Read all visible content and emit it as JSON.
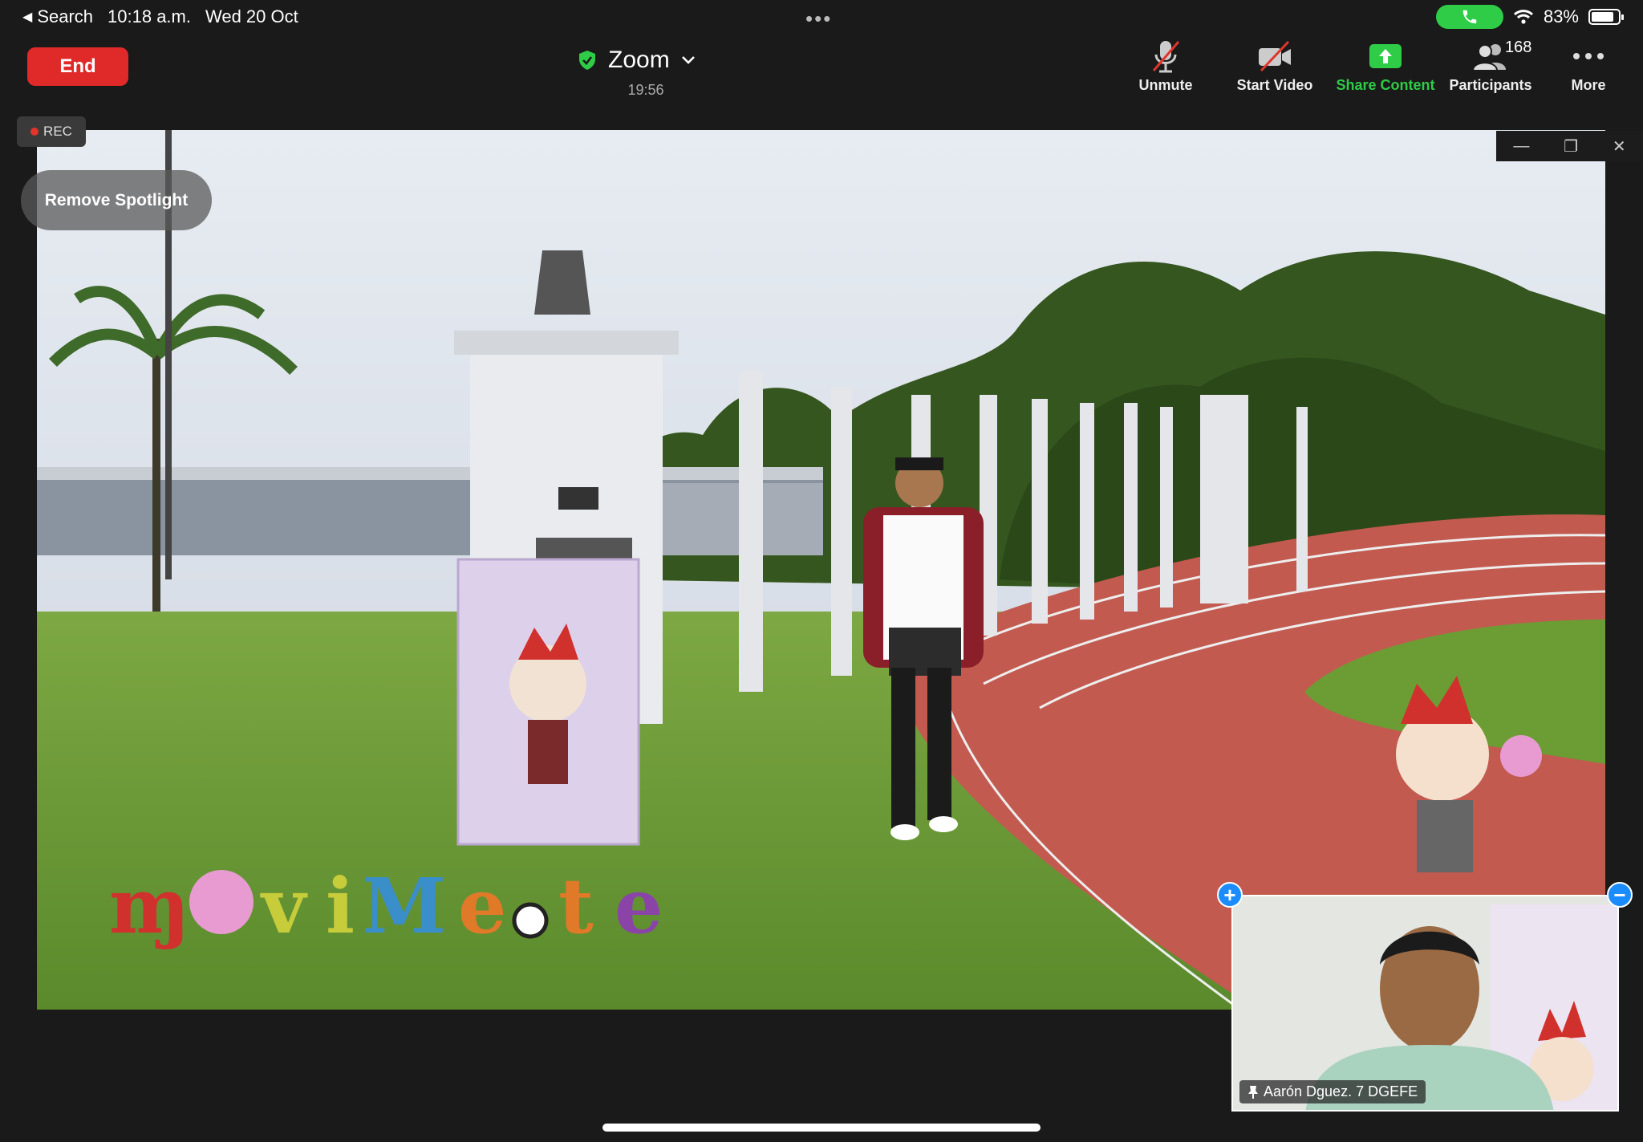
{
  "status_bar": {
    "back_label": "Search",
    "time": "10:18 a.m.",
    "date": "Wed 20 Oct",
    "battery": "83%",
    "battery_level": 0.83
  },
  "toolbar": {
    "end_label": "End",
    "meeting_title": "Zoom",
    "meeting_time": "19:56",
    "unmute_label": "Unmute",
    "start_video_label": "Start Video",
    "share_label": "Share Content",
    "participants_label": "Participants",
    "participants_count": "168",
    "more_label": "More"
  },
  "stage": {
    "rec_label": "REC",
    "remove_spotlight_label": "Remove Spotlight"
  },
  "thumbnail": {
    "participant_name": "Aarón Dguez. 7 DGEFE"
  },
  "colors": {
    "end": "#e02a2a",
    "share": "#2ecc47",
    "accent": "#1a8cff"
  }
}
